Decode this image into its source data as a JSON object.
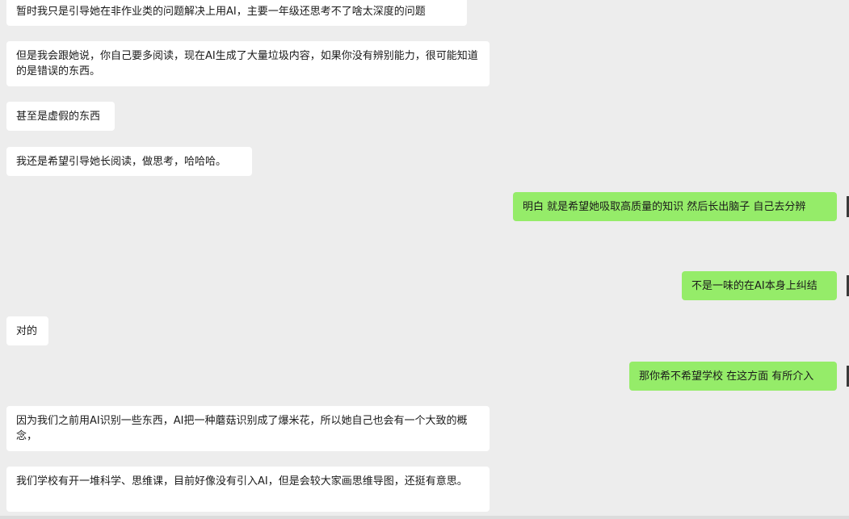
{
  "messages": [
    {
      "side": "in",
      "text": "暂时我只是引导她在非作业类的问题解决上用AI，主要一年级还思考不了啥太深度的问题"
    },
    {
      "side": "in",
      "text": "但是我会跟她说，你自己要多阅读，现在AI生成了大量垃圾内容，如果你没有辨别能力，很可能知道的是错误的东西。"
    },
    {
      "side": "in",
      "text": "甚至是虚假的东西"
    },
    {
      "side": "in",
      "text": "我还是希望引导她长阅读，做思考，哈哈哈。"
    },
    {
      "side": "out",
      "text": "明白 就是希望她吸取高质量的知识 然后长出脑子 自己去分辨"
    },
    {
      "side": "out",
      "text": "不是一味的在AI本身上纠结"
    },
    {
      "side": "in",
      "text": "对的"
    },
    {
      "side": "out",
      "text": "那你希不希望学校 在这方面 有所介入"
    },
    {
      "side": "in",
      "text": "因为我们之前用AI识别一些东西，AI把一种蘑菇识别成了爆米花，所以她自己也会有一个大致的概念，"
    },
    {
      "side": "in",
      "text": "我们学校有开一堆科学、思维课，目前好像没有引入AI，但是会较大家画思维导图，还挺有意思。"
    }
  ],
  "colors": {
    "background": "#ededed",
    "incoming_bubble": "#ffffff",
    "outgoing_bubble": "#95ec69"
  }
}
